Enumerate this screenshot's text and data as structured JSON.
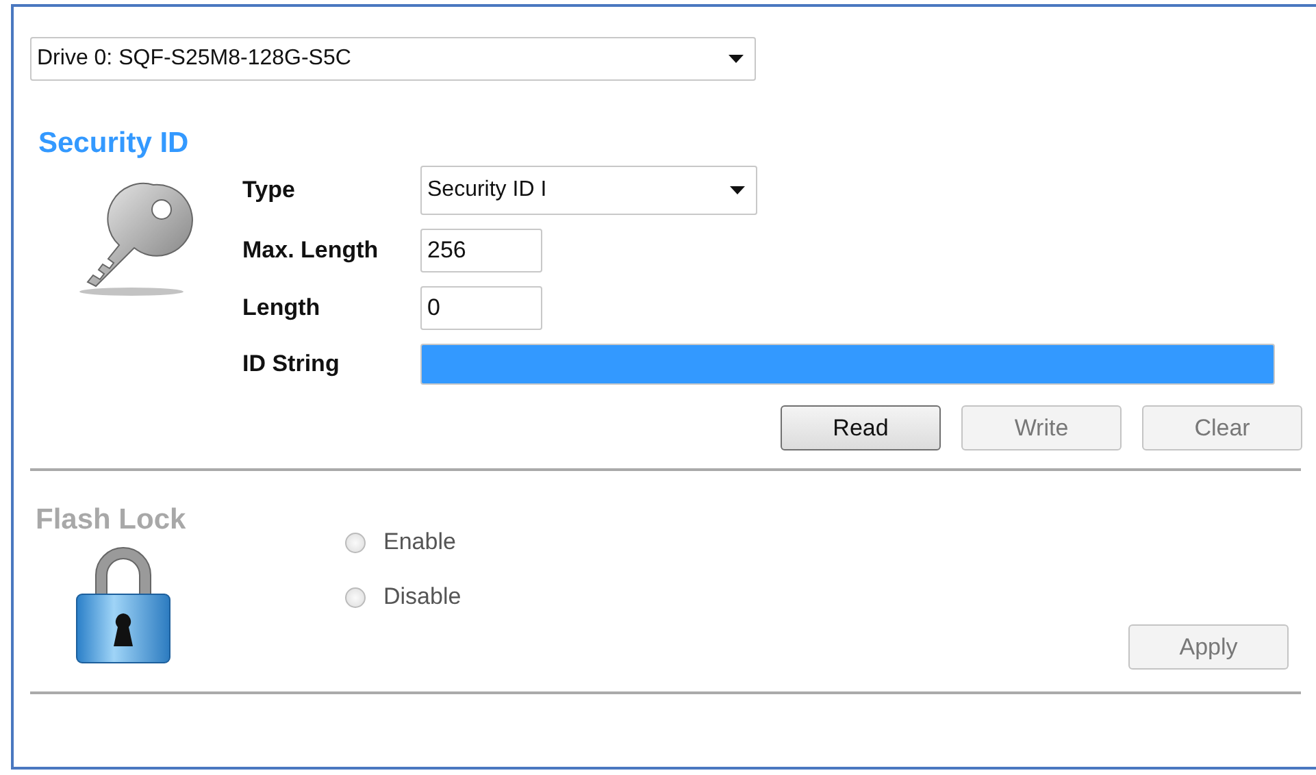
{
  "drive_select": {
    "value": "Drive 0: SQF-S25M8-128G-S5C"
  },
  "security_id": {
    "title": "Security ID",
    "disabled": false,
    "fields": [
      {
        "kind": "select",
        "label": "Type",
        "value": "Security ID I"
      },
      {
        "kind": "input",
        "label": "Max. Length",
        "value": "256"
      },
      {
        "kind": "input",
        "label": "Length",
        "value": "0"
      },
      {
        "kind": "wide",
        "label": "ID String",
        "highlighted": true
      }
    ],
    "buttons": [
      {
        "label": "Read",
        "disabled": false
      },
      {
        "label": "Write",
        "disabled": true
      },
      {
        "label": "Clear",
        "disabled": true
      }
    ]
  },
  "flash_lock": {
    "title": "Flash Lock",
    "disabled": true,
    "options": [
      {
        "label": "Enable",
        "selected": false
      },
      {
        "label": "Disable",
        "selected": false
      }
    ],
    "apply_button": {
      "label": "Apply",
      "disabled": true
    }
  }
}
